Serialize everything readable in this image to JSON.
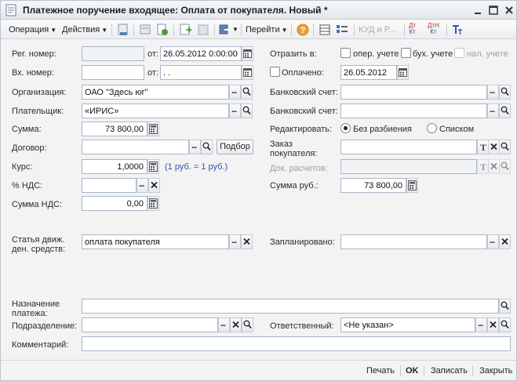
{
  "window": {
    "title": "Платежное поручение входящее: Оплата от покупателя. Новый *"
  },
  "toolbar": {
    "operation": "Операция",
    "actions": "Действия",
    "goto": "Перейти",
    "kudir": "КУД и Р...",
    "dtkt1_top": "Дт",
    "dtkt1_bot": "Кт",
    "dtkt2_top": "ДтН",
    "dtkt2_bot": "Кт"
  },
  "form": {
    "reg_number": {
      "label": "Рег. номер:",
      "value": ""
    },
    "reg_date": {
      "label": "от:",
      "value": "26.05.2012  0:00:00"
    },
    "in_number": {
      "label": "Вх. номер:",
      "value": ""
    },
    "in_date": {
      "label": "от:",
      "value": " .  ."
    },
    "reflect": {
      "label": "Отразить в:",
      "oper": "опер. учете",
      "buh": "бух. учете",
      "nal": "нал. учете"
    },
    "paid": {
      "label": "Оплачено:",
      "date": "26.05.2012"
    },
    "organization": {
      "label": "Организация:",
      "value": "ОАО \"Здесь юг\""
    },
    "payer": {
      "label": "Плательщик:",
      "value": "«ИРИС»"
    },
    "bank_account1": {
      "label": "Банковский счет:",
      "value": ""
    },
    "bank_account2": {
      "label": "Банковский счет:",
      "value": ""
    },
    "amount": {
      "label": "Сумма:",
      "value": "73 800,00"
    },
    "edit": {
      "label": "Редактировать:",
      "option1": "Без разбиения",
      "option2": "Списком"
    },
    "contract": {
      "label": "Договор:",
      "value": "",
      "select_button": "Подбор"
    },
    "customer_order": {
      "label": "Заказ покупателя:",
      "value": ""
    },
    "rate": {
      "label": "Курс:",
      "value": "1,0000",
      "note": "(1 руб. = 1 руб.)"
    },
    "settlement_doc": {
      "label": "Док. расчетов:",
      "value": ""
    },
    "vat_rate": {
      "label": "% НДС:",
      "value": ""
    },
    "amount_rub": {
      "label": "Сумма руб.:",
      "value": "73 800,00"
    },
    "vat_amount": {
      "label": "Сумма НДС:",
      "value": "0,00"
    },
    "cash_flow": {
      "label": "Статья движ. ден. средств:",
      "value": "оплата покупателя"
    },
    "planned": {
      "label": "Запланировано:",
      "value": ""
    },
    "purpose": {
      "label": "Назначение платежа:",
      "value": ""
    },
    "department": {
      "label": "Подразделение:",
      "value": ""
    },
    "responsible": {
      "label": "Ответственный:",
      "value": "<Не указан>"
    },
    "comment": {
      "label": "Комментарий:",
      "value": ""
    }
  },
  "footer": {
    "print": "Печать",
    "ok": "OK",
    "save": "Записать",
    "close": "Закрыть"
  }
}
